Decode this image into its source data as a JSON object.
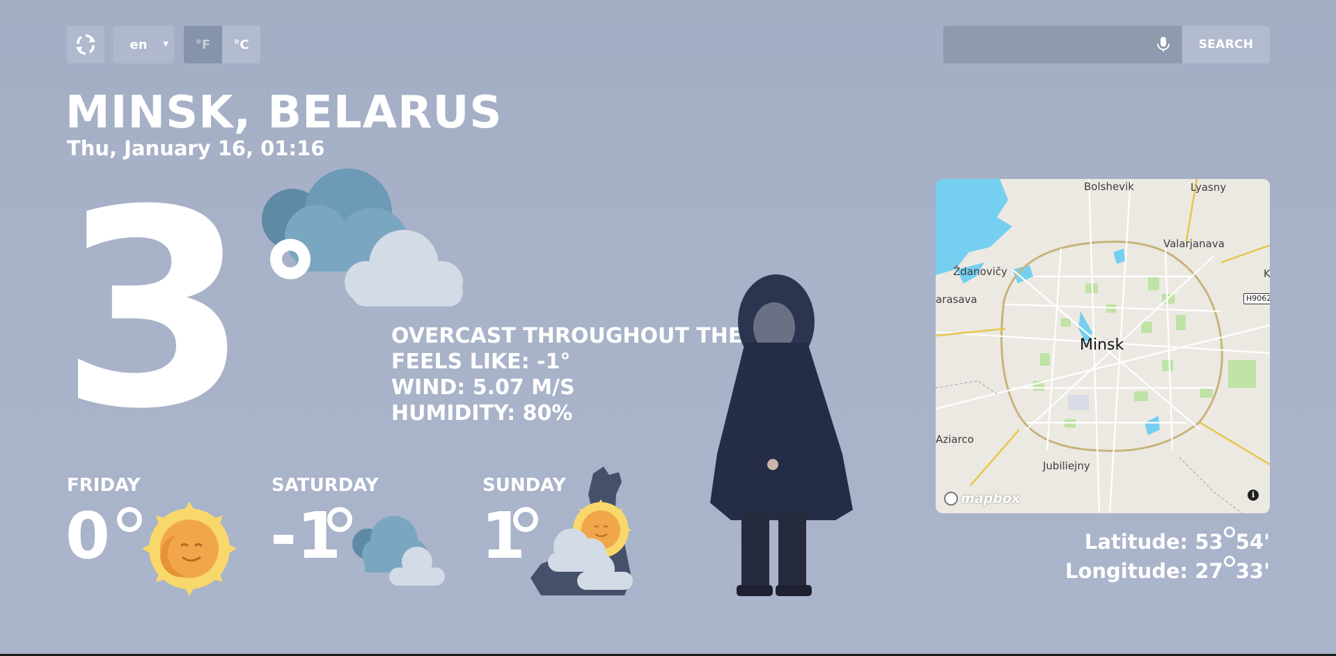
{
  "controls": {
    "refresh_icon": "refresh-icon",
    "language": "en",
    "unit_f": "°F",
    "unit_c": "°C",
    "active_unit": "°C"
  },
  "search": {
    "placeholder": "",
    "value": "",
    "mic_icon": "microphone-icon",
    "button_label": "SEARCH"
  },
  "location": {
    "city": "MINSK, BELARUS",
    "datetime": "Thu, January 16, 01:16"
  },
  "current": {
    "temperature": "3",
    "icon": "overcast-clouds-icon",
    "summary": "OVERCAST THROUGHOUT THE DAY.",
    "feels_like": "FEELS LIKE: -1°",
    "wind": "WIND: 5.07 M/S",
    "humidity": "HUMIDITY: 80%"
  },
  "forecast": [
    {
      "day": "FRIDAY",
      "temp": "0",
      "icon": "sun-icon"
    },
    {
      "day": "SATURDAY",
      "temp": "-1",
      "icon": "clouds-icon"
    },
    {
      "day": "SUNDAY",
      "temp": "1",
      "icon": "sun-behind-clouds-icon"
    }
  ],
  "map": {
    "city_label": "Minsk",
    "labels": [
      "Bolshevik",
      "Lyasny",
      "Valarjanava",
      "Ždanovičy",
      "arasava",
      "Aziarco",
      "Jubiliejny",
      "K"
    ],
    "shield": "H9062",
    "attribution": "mapbox",
    "info": "i"
  },
  "coordinates": {
    "latitude_label": "Latitude:",
    "latitude_deg": "53",
    "latitude_min": "54'",
    "longitude_label": "Longitude:",
    "longitude_deg": "27",
    "longitude_min": "33'"
  },
  "colors": {
    "background": "#a5afc6",
    "text": "#ffffff",
    "cloud_dark": "#5e8aa6",
    "cloud_light": "#d3dbe6",
    "sun": "#f8d86a",
    "sun_face": "#f2a64a",
    "map_water": "#75cff0",
    "map_green": "#bfe3a6"
  }
}
